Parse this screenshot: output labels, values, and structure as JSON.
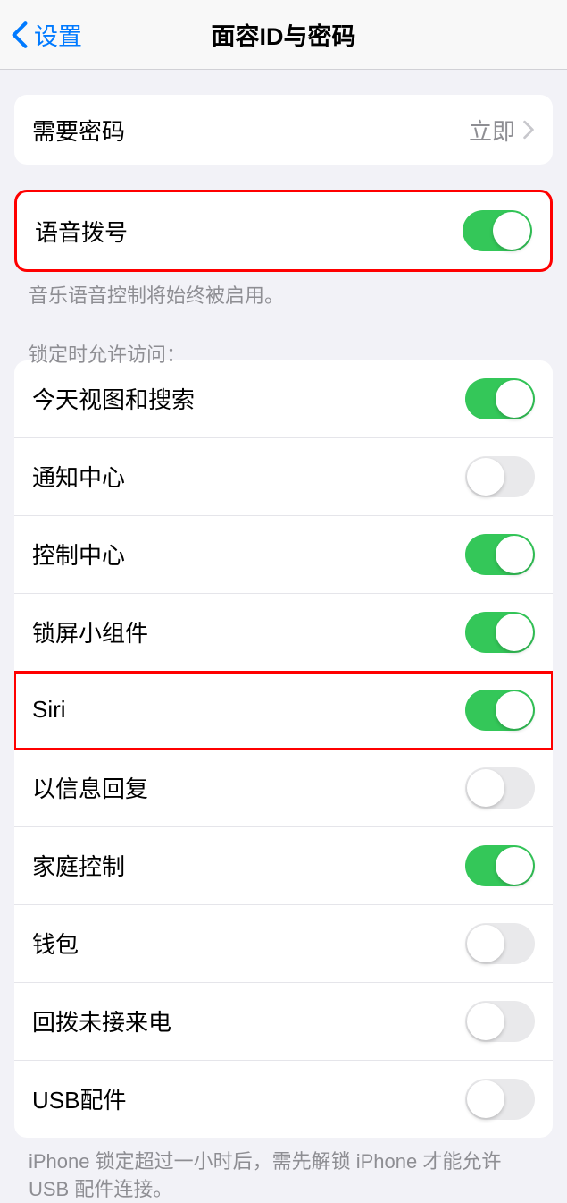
{
  "header": {
    "back_label": "设置",
    "title": "面容ID与密码"
  },
  "require_passcode": {
    "label": "需要密码",
    "value": "立即"
  },
  "voice_dial": {
    "label": "语音拨号",
    "enabled": true,
    "footer": "音乐语音控制将始终被启用。"
  },
  "lock_access": {
    "header": "锁定时允许访问：",
    "items": [
      {
        "label": "今天视图和搜索",
        "enabled": true
      },
      {
        "label": "通知中心",
        "enabled": false
      },
      {
        "label": "控制中心",
        "enabled": true
      },
      {
        "label": "锁屏小组件",
        "enabled": true
      },
      {
        "label": "Siri",
        "enabled": true
      },
      {
        "label": "以信息回复",
        "enabled": false
      },
      {
        "label": "家庭控制",
        "enabled": true
      },
      {
        "label": "钱包",
        "enabled": false
      },
      {
        "label": "回拨未接来电",
        "enabled": false
      },
      {
        "label": "USB配件",
        "enabled": false
      }
    ],
    "footer": "iPhone 锁定超过一小时后，需先解锁 iPhone 才能允许 USB 配件连接。"
  }
}
